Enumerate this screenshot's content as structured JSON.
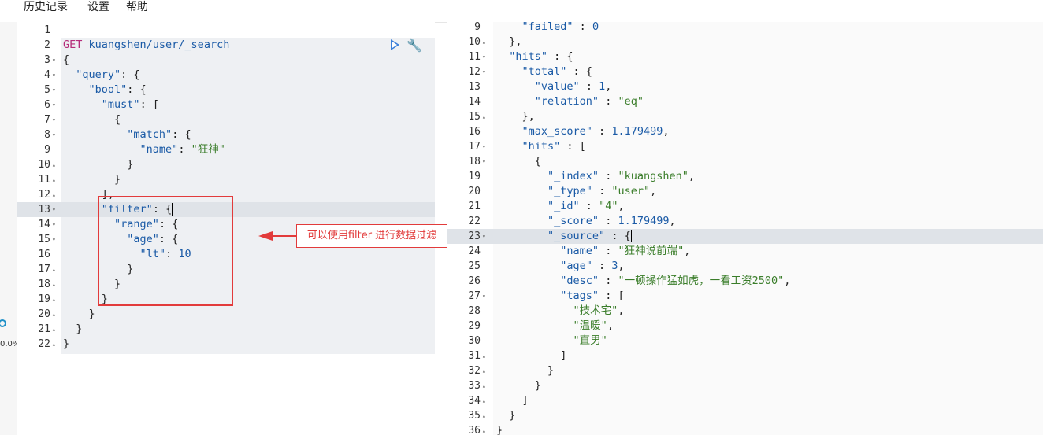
{
  "menu": [
    "历史记录",
    "设置",
    "帮助"
  ],
  "sidebar": {
    "text": "0.0%",
    "close": "×"
  },
  "request": {
    "lines": [
      {
        "n": "1",
        "f": "",
        "t": []
      },
      {
        "n": "2",
        "f": "",
        "t": [
          [
            "m",
            "GET "
          ],
          [
            "u",
            "kuangshen/user/_search"
          ]
        ]
      },
      {
        "n": "3",
        "f": "▾",
        "t": [
          [
            "p",
            "{"
          ]
        ]
      },
      {
        "n": "4",
        "f": "▾",
        "t": [
          [
            "p",
            "  "
          ],
          [
            "k",
            "\"query\""
          ],
          [
            "p",
            ": {"
          ]
        ]
      },
      {
        "n": "5",
        "f": "▾",
        "t": [
          [
            "p",
            "    "
          ],
          [
            "k",
            "\"bool\""
          ],
          [
            "p",
            ": {"
          ]
        ]
      },
      {
        "n": "6",
        "f": "▾",
        "t": [
          [
            "p",
            "      "
          ],
          [
            "k",
            "\"must\""
          ],
          [
            "p",
            ": ["
          ]
        ]
      },
      {
        "n": "7",
        "f": "▾",
        "t": [
          [
            "p",
            "        {"
          ]
        ]
      },
      {
        "n": "8",
        "f": "▾",
        "t": [
          [
            "p",
            "          "
          ],
          [
            "k",
            "\"match\""
          ],
          [
            "p",
            ": {"
          ]
        ]
      },
      {
        "n": "9",
        "f": "",
        "t": [
          [
            "p",
            "            "
          ],
          [
            "k",
            "\"name\""
          ],
          [
            "p",
            ": "
          ],
          [
            "s",
            "\"狂神\""
          ]
        ]
      },
      {
        "n": "10",
        "f": "▴",
        "t": [
          [
            "p",
            "          }"
          ]
        ]
      },
      {
        "n": "11",
        "f": "▴",
        "t": [
          [
            "p",
            "        }"
          ]
        ]
      },
      {
        "n": "12",
        "f": "▴",
        "t": [
          [
            "p",
            "      ],"
          ]
        ]
      },
      {
        "n": "13",
        "f": "▾",
        "t": [
          [
            "p",
            "      "
          ],
          [
            "k",
            "\"filter\""
          ],
          [
            "p",
            ": {"
          ]
        ]
      },
      {
        "n": "14",
        "f": "▾",
        "t": [
          [
            "p",
            "        "
          ],
          [
            "k",
            "\"range\""
          ],
          [
            "p",
            ": {"
          ]
        ]
      },
      {
        "n": "15",
        "f": "▾",
        "t": [
          [
            "p",
            "          "
          ],
          [
            "k",
            "\"age\""
          ],
          [
            "p",
            ": {"
          ]
        ]
      },
      {
        "n": "16",
        "f": "",
        "t": [
          [
            "p",
            "            "
          ],
          [
            "k",
            "\"lt\""
          ],
          [
            "p",
            ": "
          ],
          [
            "n",
            "10"
          ]
        ]
      },
      {
        "n": "17",
        "f": "▴",
        "t": [
          [
            "p",
            "          }"
          ]
        ]
      },
      {
        "n": "18",
        "f": "▴",
        "t": [
          [
            "p",
            "        }"
          ]
        ]
      },
      {
        "n": "19",
        "f": "▴",
        "t": [
          [
            "p",
            "      }"
          ]
        ]
      },
      {
        "n": "20",
        "f": "▴",
        "t": [
          [
            "p",
            "    }"
          ]
        ]
      },
      {
        "n": "21",
        "f": "▴",
        "t": [
          [
            "p",
            "  }"
          ]
        ]
      },
      {
        "n": "22",
        "f": "▴",
        "t": [
          [
            "p",
            "}"
          ]
        ]
      }
    ]
  },
  "annotation": "可以使用filter 进行数据过滤",
  "response": {
    "lines": [
      {
        "n": "9",
        "f": "",
        "t": [
          [
            "p",
            "    "
          ],
          [
            "k",
            "\"failed\""
          ],
          [
            "p",
            " : "
          ],
          [
            "n",
            "0"
          ]
        ]
      },
      {
        "n": "10",
        "f": "▴",
        "t": [
          [
            "p",
            "  },"
          ]
        ]
      },
      {
        "n": "11",
        "f": "▾",
        "t": [
          [
            "p",
            "  "
          ],
          [
            "k",
            "\"hits\""
          ],
          [
            "p",
            " : {"
          ]
        ]
      },
      {
        "n": "12",
        "f": "▾",
        "t": [
          [
            "p",
            "    "
          ],
          [
            "k",
            "\"total\""
          ],
          [
            "p",
            " : {"
          ]
        ]
      },
      {
        "n": "13",
        "f": "",
        "t": [
          [
            "p",
            "      "
          ],
          [
            "k",
            "\"value\""
          ],
          [
            "p",
            " : "
          ],
          [
            "n",
            "1"
          ],
          [
            "p",
            ","
          ]
        ]
      },
      {
        "n": "14",
        "f": "",
        "t": [
          [
            "p",
            "      "
          ],
          [
            "k",
            "\"relation\""
          ],
          [
            "p",
            " : "
          ],
          [
            "s",
            "\"eq\""
          ]
        ]
      },
      {
        "n": "15",
        "f": "▴",
        "t": [
          [
            "p",
            "    },"
          ]
        ]
      },
      {
        "n": "16",
        "f": "",
        "t": [
          [
            "p",
            "    "
          ],
          [
            "k",
            "\"max_score\""
          ],
          [
            "p",
            " : "
          ],
          [
            "n",
            "1.179499"
          ],
          [
            "p",
            ","
          ]
        ]
      },
      {
        "n": "17",
        "f": "▾",
        "t": [
          [
            "p",
            "    "
          ],
          [
            "k",
            "\"hits\""
          ],
          [
            "p",
            " : ["
          ]
        ]
      },
      {
        "n": "18",
        "f": "▾",
        "t": [
          [
            "p",
            "      {"
          ]
        ]
      },
      {
        "n": "19",
        "f": "",
        "t": [
          [
            "p",
            "        "
          ],
          [
            "k",
            "\"_index\""
          ],
          [
            "p",
            " : "
          ],
          [
            "s",
            "\"kuangshen\""
          ],
          [
            "p",
            ","
          ]
        ]
      },
      {
        "n": "20",
        "f": "",
        "t": [
          [
            "p",
            "        "
          ],
          [
            "k",
            "\"_type\""
          ],
          [
            "p",
            " : "
          ],
          [
            "s",
            "\"user\""
          ],
          [
            "p",
            ","
          ]
        ]
      },
      {
        "n": "21",
        "f": "",
        "t": [
          [
            "p",
            "        "
          ],
          [
            "k",
            "\"_id\""
          ],
          [
            "p",
            " : "
          ],
          [
            "s",
            "\"4\""
          ],
          [
            "p",
            ","
          ]
        ]
      },
      {
        "n": "22",
        "f": "",
        "t": [
          [
            "p",
            "        "
          ],
          [
            "k",
            "\"_score\""
          ],
          [
            "p",
            " : "
          ],
          [
            "n",
            "1.179499"
          ],
          [
            "p",
            ","
          ]
        ]
      },
      {
        "n": "23",
        "f": "▾",
        "t": [
          [
            "p",
            "        "
          ],
          [
            "k",
            "\"_source\""
          ],
          [
            "p",
            " : {"
          ]
        ]
      },
      {
        "n": "24",
        "f": "",
        "t": [
          [
            "p",
            "          "
          ],
          [
            "k",
            "\"name\""
          ],
          [
            "p",
            " : "
          ],
          [
            "s",
            "\"狂神说前端\""
          ],
          [
            "p",
            ","
          ]
        ]
      },
      {
        "n": "25",
        "f": "",
        "t": [
          [
            "p",
            "          "
          ],
          [
            "k",
            "\"age\""
          ],
          [
            "p",
            " : "
          ],
          [
            "n",
            "3"
          ],
          [
            "p",
            ","
          ]
        ]
      },
      {
        "n": "26",
        "f": "",
        "t": [
          [
            "p",
            "          "
          ],
          [
            "k",
            "\"desc\""
          ],
          [
            "p",
            " : "
          ],
          [
            "s",
            "\"一顿操作猛如虎，一看工资2500\""
          ],
          [
            "p",
            ","
          ]
        ]
      },
      {
        "n": "27",
        "f": "▾",
        "t": [
          [
            "p",
            "          "
          ],
          [
            "k",
            "\"tags\""
          ],
          [
            "p",
            " : ["
          ]
        ]
      },
      {
        "n": "28",
        "f": "",
        "t": [
          [
            "p",
            "            "
          ],
          [
            "s",
            "\"技术宅\""
          ],
          [
            "p",
            ","
          ]
        ]
      },
      {
        "n": "29",
        "f": "",
        "t": [
          [
            "p",
            "            "
          ],
          [
            "s",
            "\"温暖\""
          ],
          [
            "p",
            ","
          ]
        ]
      },
      {
        "n": "30",
        "f": "",
        "t": [
          [
            "p",
            "            "
          ],
          [
            "s",
            "\"直男\""
          ]
        ]
      },
      {
        "n": "31",
        "f": "▴",
        "t": [
          [
            "p",
            "          ]"
          ]
        ]
      },
      {
        "n": "32",
        "f": "▴",
        "t": [
          [
            "p",
            "        }"
          ]
        ]
      },
      {
        "n": "33",
        "f": "▴",
        "t": [
          [
            "p",
            "      }"
          ]
        ]
      },
      {
        "n": "34",
        "f": "▴",
        "t": [
          [
            "p",
            "    ]"
          ]
        ]
      },
      {
        "n": "35",
        "f": "▴",
        "t": [
          [
            "p",
            "  }"
          ]
        ]
      },
      {
        "n": "36",
        "f": "▴",
        "t": [
          [
            "p",
            "}"
          ]
        ]
      }
    ]
  }
}
